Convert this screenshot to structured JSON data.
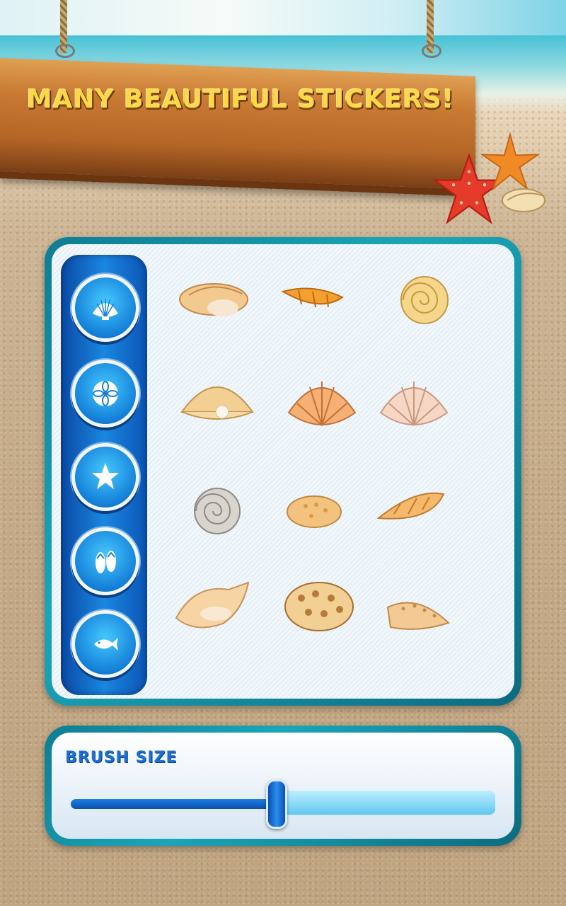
{
  "banner": {
    "title": "MANY BEAUTIFUL STICKERS!"
  },
  "categories": [
    {
      "name": "shells",
      "icon": "scallop-shell-icon"
    },
    {
      "name": "flowers",
      "icon": "sand-dollar-icon"
    },
    {
      "name": "starfish",
      "icon": "starfish-icon"
    },
    {
      "name": "flip-flops",
      "icon": "flip-flops-icon"
    },
    {
      "name": "fish",
      "icon": "fish-icon"
    }
  ],
  "stickers": [
    "conch-shell",
    "spiral-shell",
    "nautilus-shell",
    "pearl-clam-shell",
    "orange-scallop-shell",
    "pink-scallop-shell",
    "grey-spiral-shell",
    "spotted-cowrie-shell",
    "cone-shell",
    "queen-conch-shell",
    "tun-shell",
    "whelk-shell"
  ],
  "brush": {
    "label": "BRUSH SIZE",
    "value": 0.48
  },
  "colors": {
    "accent": "#1c6fd8",
    "panel_border": "#1aa6b8",
    "sign_text": "#ffd84a"
  }
}
